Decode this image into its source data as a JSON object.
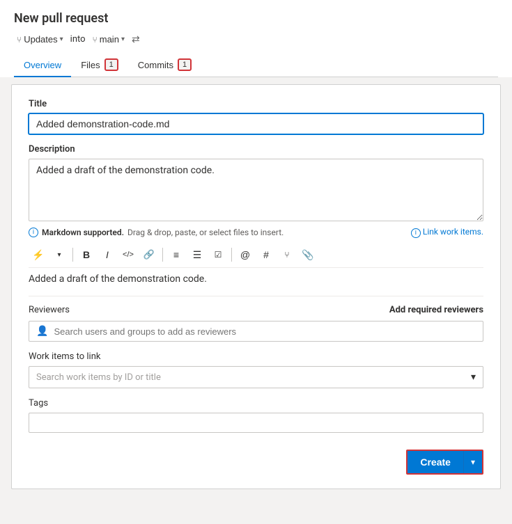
{
  "page": {
    "title": "New pull request"
  },
  "branch_row": {
    "source_icon": "⑂",
    "source_label": "Updates",
    "into_label": "into",
    "target_icon": "⑂",
    "target_label": "main",
    "swap_icon": "⇄"
  },
  "tabs": [
    {
      "id": "overview",
      "label": "Overview",
      "badge": null,
      "active": true
    },
    {
      "id": "files",
      "label": "Files",
      "badge": "1",
      "active": false
    },
    {
      "id": "commits",
      "label": "Commits",
      "badge": "1",
      "active": false
    }
  ],
  "form": {
    "title_label": "Title",
    "title_value": "Added demonstration-code.md",
    "description_label": "Description",
    "description_value": "Added a draft of the demonstration code.",
    "markdown_hint": "Markdown supported.",
    "drag_drop_hint": "Drag & drop, paste, or select files to insert.",
    "link_work_items": "Link work items.",
    "preview_text": "Added a draft of the demonstration code.",
    "reviewers_label": "Reviewers",
    "add_reviewers_label": "Add required reviewers",
    "reviewers_placeholder": "Search users and groups to add as reviewers",
    "work_items_label": "Work items to link",
    "work_items_placeholder": "Search work items by ID or title",
    "tags_label": "Tags",
    "tags_value": "",
    "create_label": "Create"
  },
  "toolbar": {
    "items": [
      {
        "name": "format-bolt",
        "symbol": "⚡"
      },
      {
        "name": "chevron-down",
        "symbol": "▾"
      },
      {
        "name": "bold",
        "symbol": "B"
      },
      {
        "name": "italic",
        "symbol": "I"
      },
      {
        "name": "code",
        "symbol": "</>"
      },
      {
        "name": "link",
        "symbol": "🔗"
      },
      {
        "name": "ordered-list",
        "symbol": "≡"
      },
      {
        "name": "unordered-list",
        "symbol": "☰"
      },
      {
        "name": "task-list",
        "symbol": "☑"
      },
      {
        "name": "mention",
        "symbol": "@"
      },
      {
        "name": "heading",
        "symbol": "#"
      },
      {
        "name": "pull-request",
        "symbol": "⑂"
      },
      {
        "name": "attach",
        "symbol": "📎"
      }
    ]
  }
}
